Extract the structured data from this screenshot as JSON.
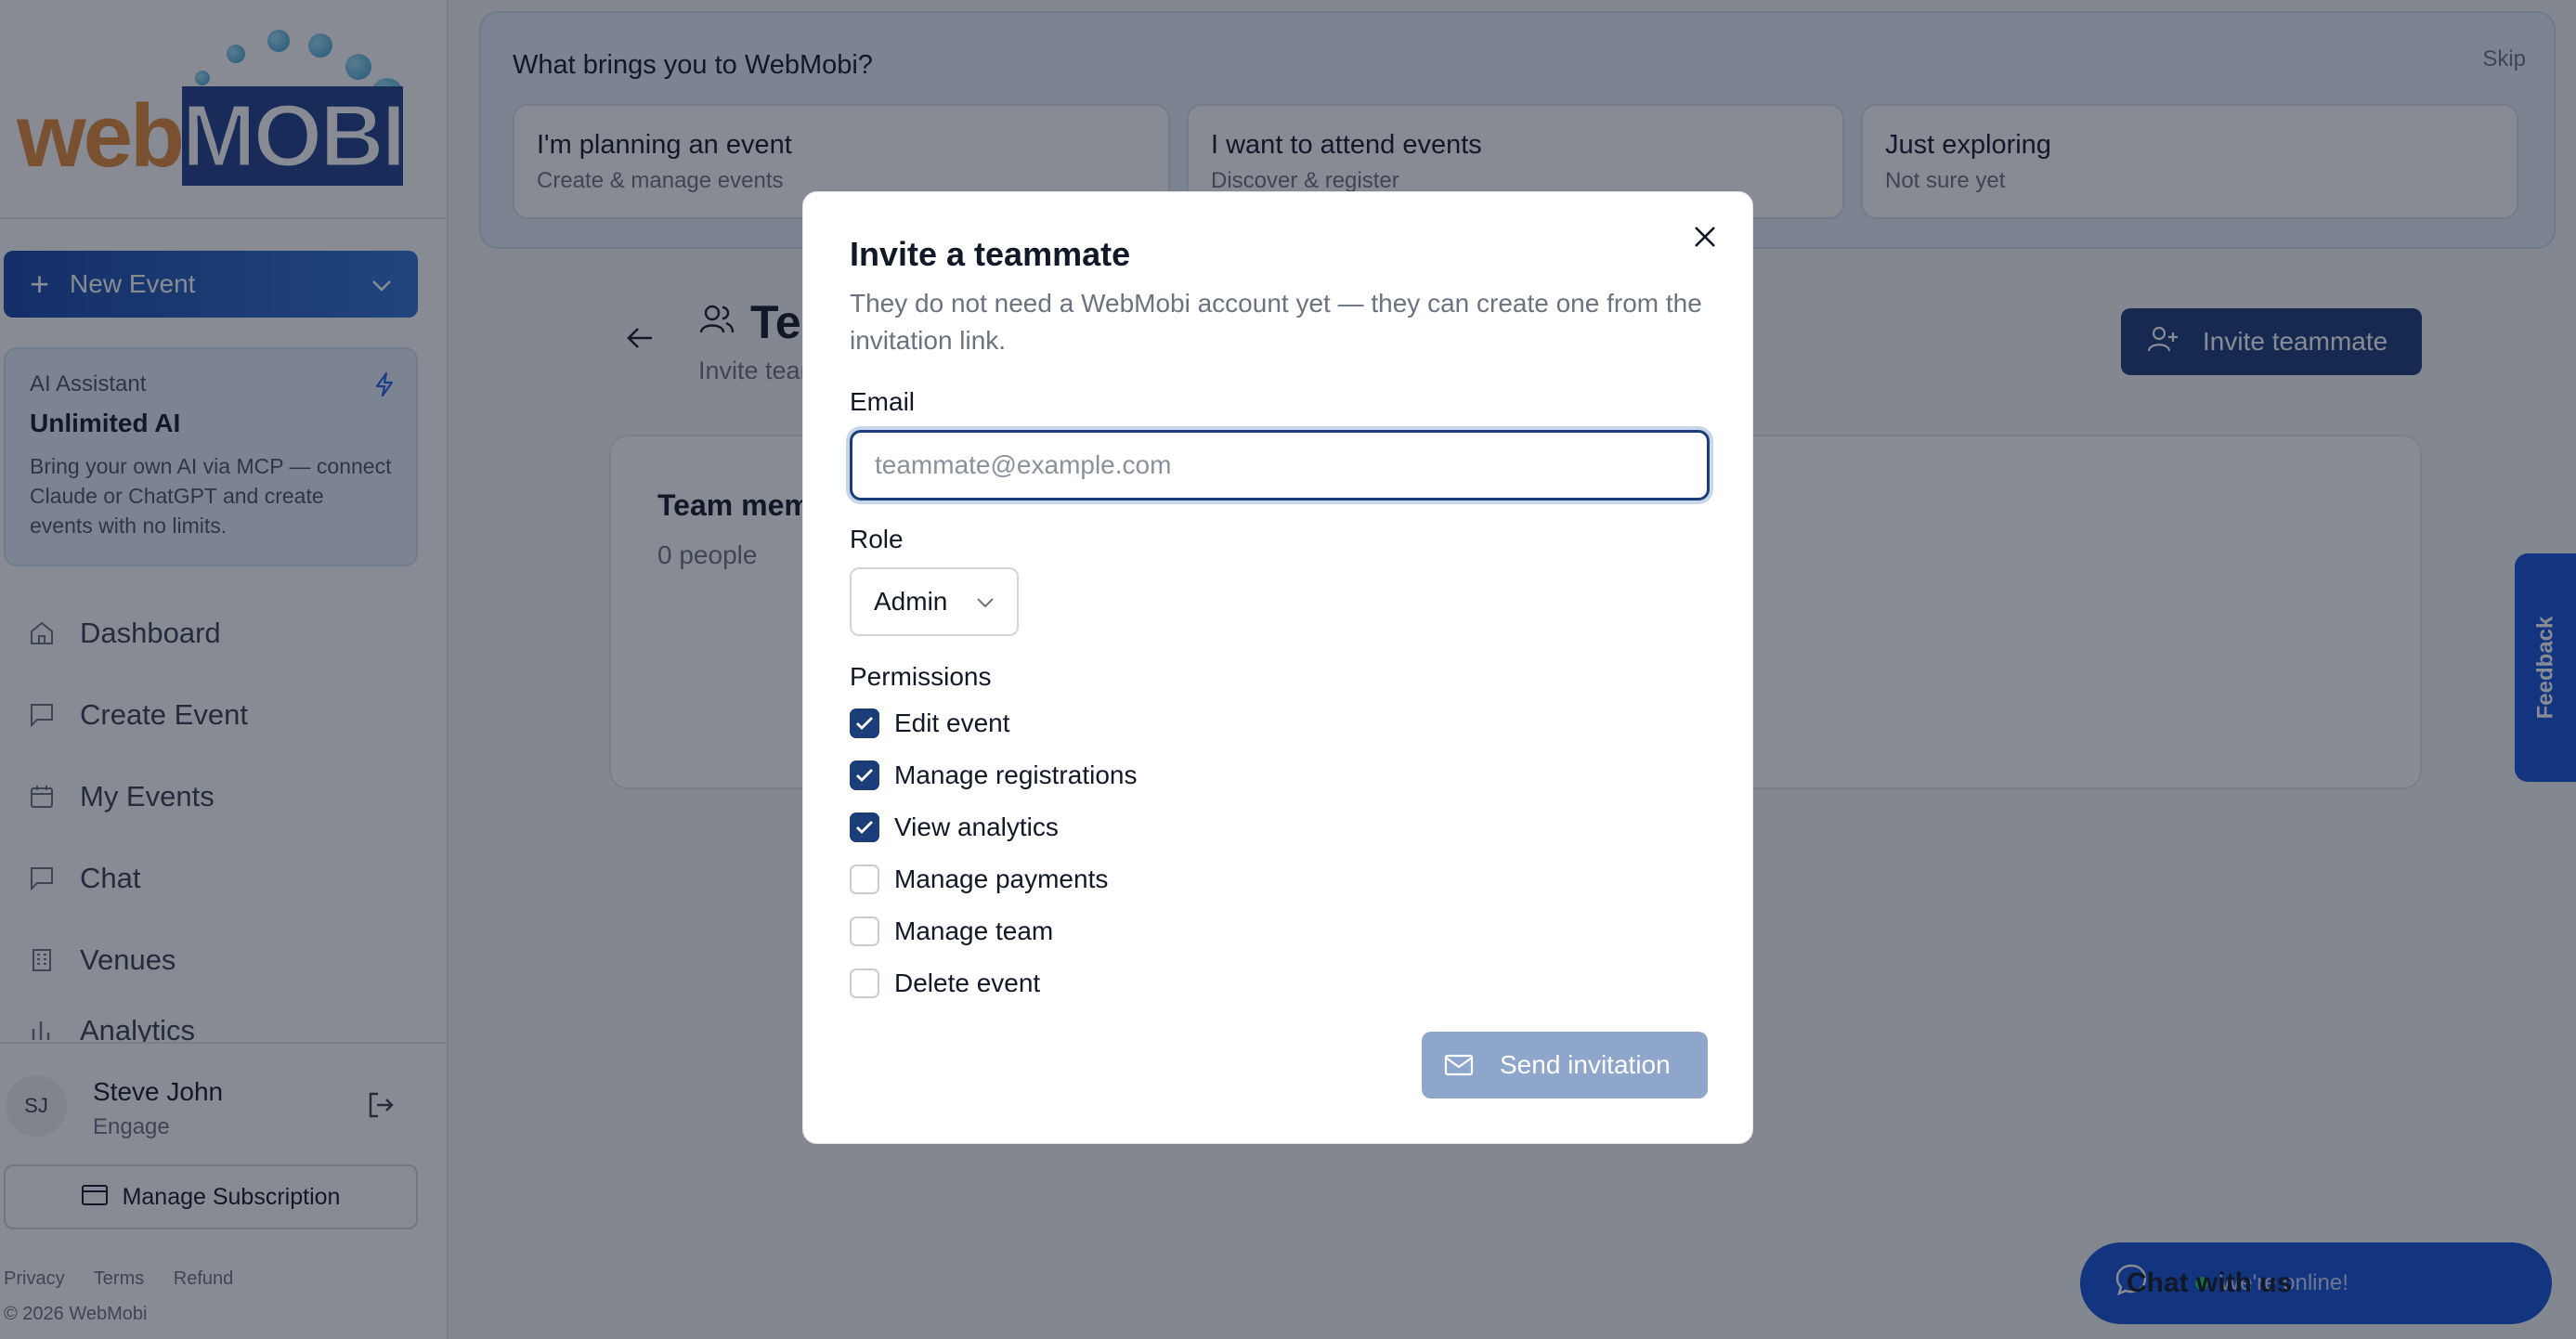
{
  "brand": {
    "logo_web": "web",
    "logo_mobi": "MOBI"
  },
  "sidebar": {
    "new_event_label": "New Event",
    "ai": {
      "small": "AI Assistant",
      "title": "Unlimited AI",
      "desc": "Bring your own AI via MCP — connect Claude or ChatGPT and create events with no limits."
    },
    "nav": [
      {
        "label": "Dashboard",
        "icon": "home-icon"
      },
      {
        "label": "Create Event",
        "icon": "chat-square-icon"
      },
      {
        "label": "My Events",
        "icon": "calendar-icon"
      },
      {
        "label": "Chat",
        "icon": "chat-square-icon"
      },
      {
        "label": "Venues",
        "icon": "building-icon"
      },
      {
        "label": "Analytics",
        "icon": "chart-icon"
      }
    ],
    "user": {
      "initials": "SJ",
      "name": "Steve John",
      "plan": "Engage"
    },
    "manage_subscription": "Manage Subscription",
    "footer": {
      "privacy": "Privacy",
      "terms": "Terms",
      "refund": "Refund",
      "copyright": "© 2026 WebMobi"
    }
  },
  "welcome": {
    "question": "What brings you to WebMobi?",
    "skip": "Skip",
    "choices": [
      {
        "title": "I'm planning an event",
        "sub": "Create & manage events"
      },
      {
        "title": "I want to attend events",
        "sub": "Discover & register"
      },
      {
        "title": "Just exploring",
        "sub": "Not sure yet"
      }
    ]
  },
  "page": {
    "title": "Team",
    "subtitle": "Invite teammates",
    "invite_button": "Invite teammate",
    "card_title": "Team members",
    "card_count": "0 people"
  },
  "feedback": "Feedback",
  "chat_widget": {
    "label": "Chat with us",
    "status": "We're online!"
  },
  "modal": {
    "title": "Invite a teammate",
    "desc": "They do not need a WebMobi account yet — they can create one from the invitation link.",
    "email_label": "Email",
    "email_placeholder": "teammate@example.com",
    "role_label": "Role",
    "role_value": "Admin",
    "permissions_label": "Permissions",
    "permissions": [
      {
        "label": "Edit event",
        "checked": true
      },
      {
        "label": "Manage registrations",
        "checked": true
      },
      {
        "label": "View analytics",
        "checked": true
      },
      {
        "label": "Manage payments",
        "checked": false
      },
      {
        "label": "Manage team",
        "checked": false
      },
      {
        "label": "Delete event",
        "checked": false
      }
    ],
    "send_button": "Send invitation"
  },
  "colors": {
    "primary": "#1b3d7a",
    "accent": "#1553d6",
    "online": "#22c55e"
  }
}
